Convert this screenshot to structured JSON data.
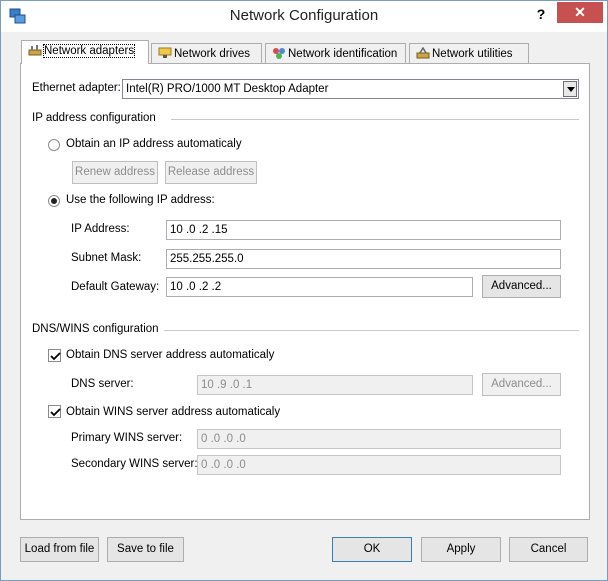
{
  "window": {
    "title": "Network Configuration",
    "help_label": "?",
    "close_label": "✕"
  },
  "tabs": [
    {
      "label": "Network adapters",
      "icon": "network-adapter-icon",
      "active": true
    },
    {
      "label": "Network drives",
      "icon": "network-drive-icon"
    },
    {
      "label": "Network identification",
      "icon": "network-identification-icon"
    },
    {
      "label": "Network utilities",
      "icon": "network-utilities-icon"
    }
  ],
  "adapter": {
    "label": "Ethernet adapter:",
    "value": "Intel(R) PRO/1000 MT Desktop Adapter"
  },
  "ip_section": {
    "title": "IP address configuration",
    "auto_radio_label": "Obtain an IP address automaticaly",
    "renew_label": "Renew address",
    "release_label": "Release address",
    "manual_radio_label": "Use the following IP address:",
    "manual_selected": true,
    "ip_label": "IP Address:",
    "ip_value": "10 .0  .2  .15",
    "mask_label": "Subnet Mask:",
    "mask_value": "255.255.255.0",
    "gateway_label": "Default Gateway:",
    "gateway_value": "10 .0  .2  .2",
    "advanced_label": "Advanced..."
  },
  "dns_section": {
    "title": "DNS/WINS configuration",
    "dns_auto_label": "Obtain DNS server address automaticaly",
    "dns_auto_checked": true,
    "dns_server_label": "DNS server:",
    "dns_server_value": "10 .9  .0  .1",
    "dns_advanced_label": "Advanced...",
    "wins_auto_label": "Obtain WINS server address automaticaly",
    "wins_auto_checked": true,
    "primary_wins_label": "Primary WINS server:",
    "primary_wins_value": "0  .0  .0  .0",
    "secondary_wins_label": "Secondary WINS server:",
    "secondary_wins_value": "0  .0  .0  .0"
  },
  "footer": {
    "load_label": "Load from file",
    "save_label": "Save to file",
    "ok_label": "OK",
    "apply_label": "Apply",
    "cancel_label": "Cancel"
  },
  "colors": {
    "close_button": "#c75050",
    "window_border": "#7a9cbe",
    "dialog_bg": "#f0f0f0"
  }
}
